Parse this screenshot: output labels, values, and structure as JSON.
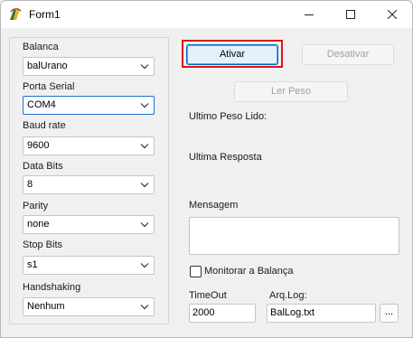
{
  "window": {
    "title": "Form1"
  },
  "serial": {
    "balanca_label": "Balanca",
    "balanca_value": "balUrano",
    "porta_label": "Porta Serial",
    "porta_value": "COM4",
    "baud_label": "Baud rate",
    "baud_value": "9600",
    "databits_label": "Data Bits",
    "databits_value": "8",
    "parity_label": "Parity",
    "parity_value": "none",
    "stopbits_label": "Stop Bits",
    "stopbits_value": "s1",
    "handshaking_label": "Handshaking",
    "handshaking_value": "Nenhum"
  },
  "actions": {
    "ativar": "Ativar",
    "desativar": "Desativar",
    "ler_peso": "Ler Peso"
  },
  "info": {
    "ultimo_peso_label": "Ultimo Peso Lido:",
    "ultima_resposta_label": "Ultima Resposta",
    "mensagem_label": "Mensagem",
    "monitorar_label": "Monitorar a Balança",
    "monitorar_checked": false,
    "timeout_label": "TimeOut",
    "timeout_value": "2000",
    "arqlog_label": "Arq.Log:",
    "arqlog_value": "BalLog.txt",
    "browse_label": "..."
  },
  "colors": {
    "highlight": "#e01010",
    "focus": "#0067c0"
  },
  "icons": {
    "app": "delphi-helmet-icon",
    "minimize": "minimize-icon",
    "maximize": "maximize-icon",
    "close": "close-icon",
    "dropdown": "chevron-down-icon"
  }
}
